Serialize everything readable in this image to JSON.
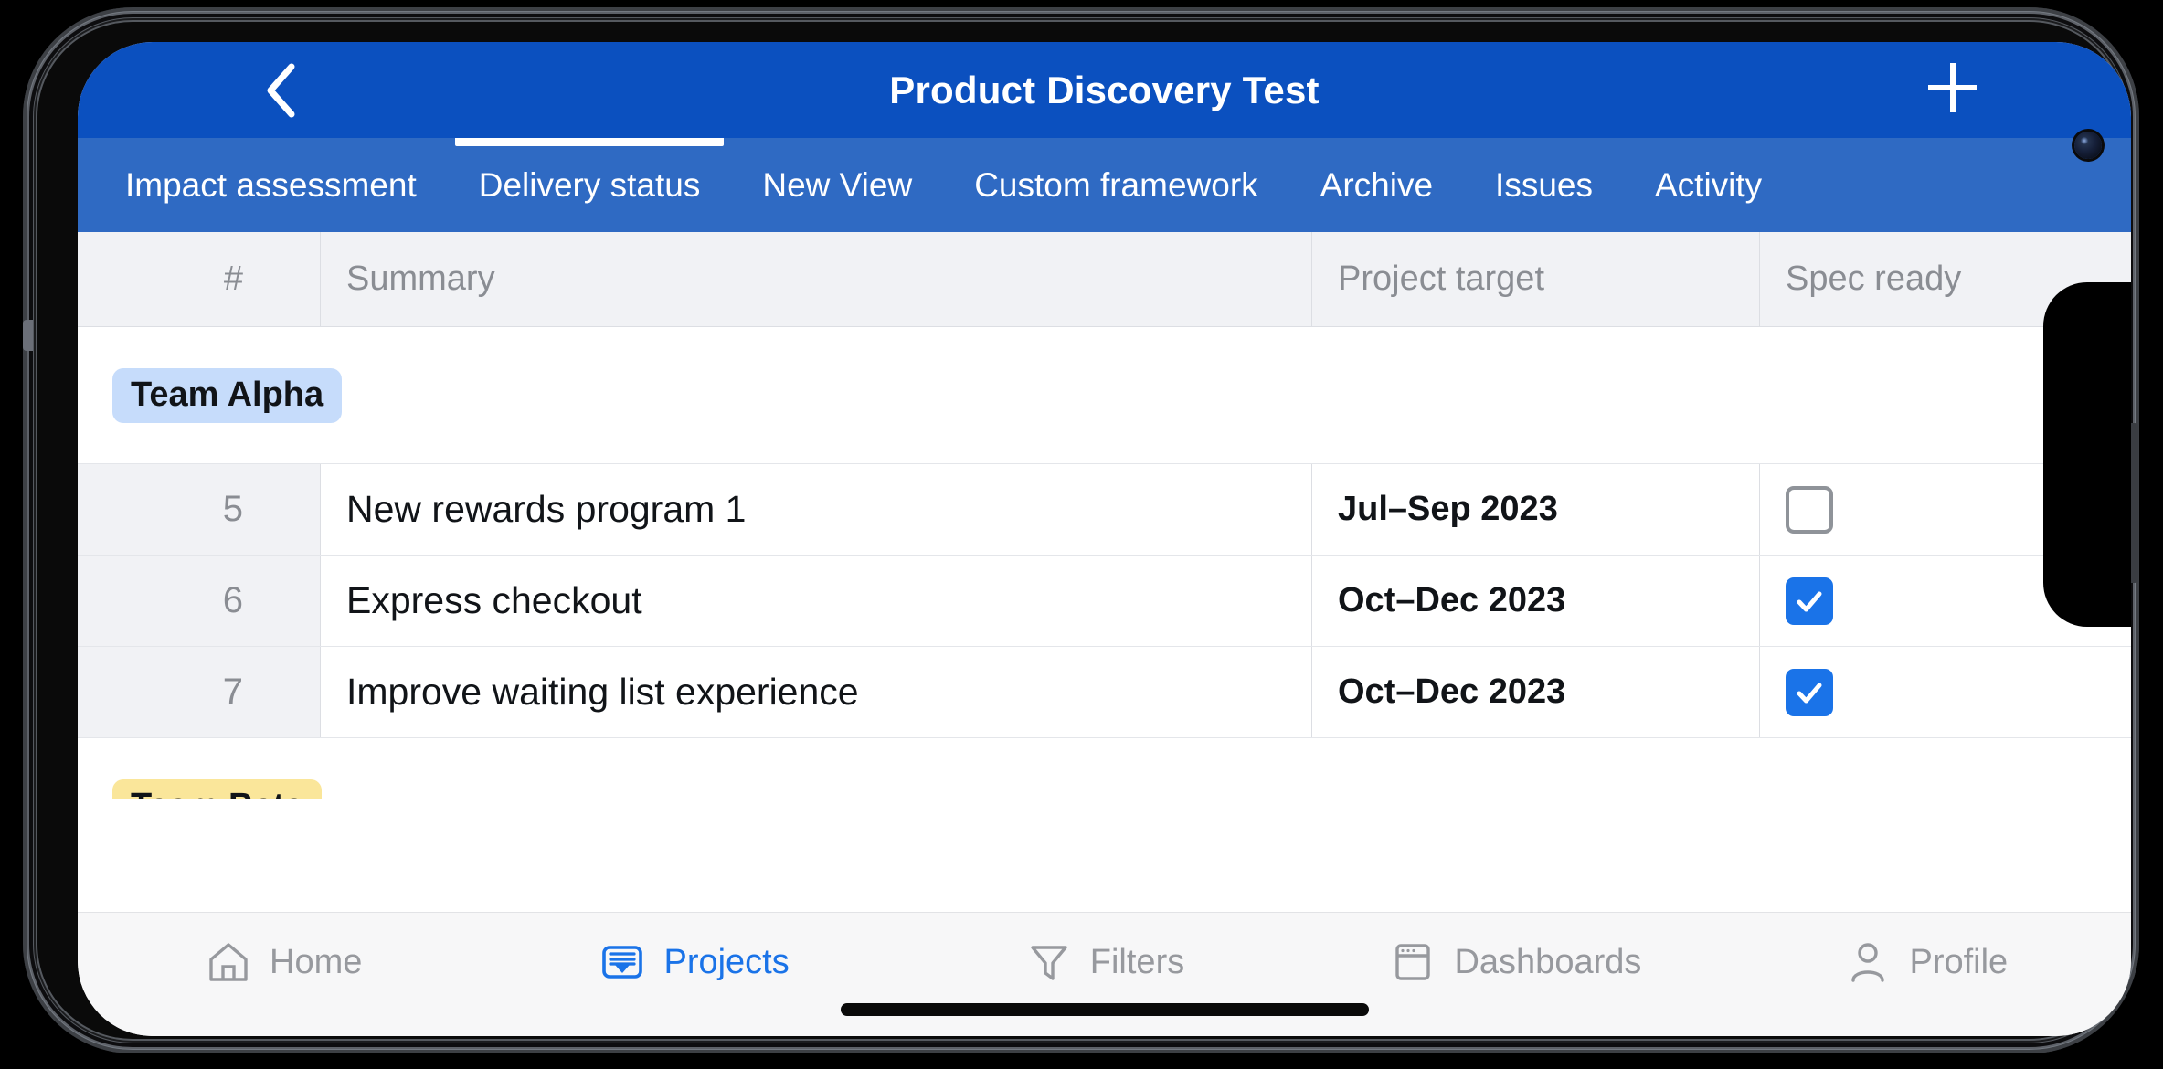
{
  "header": {
    "title": "Product Discovery Test",
    "back_icon": "chevron-left-icon",
    "add_icon": "plus-icon"
  },
  "tabs": [
    {
      "label": "Impact assessment",
      "active": false
    },
    {
      "label": "Delivery status",
      "active": true
    },
    {
      "label": "New View",
      "active": false
    },
    {
      "label": "Custom framework",
      "active": false
    },
    {
      "label": "Archive",
      "active": false
    },
    {
      "label": "Issues",
      "active": false
    },
    {
      "label": "Activity",
      "active": false
    }
  ],
  "table": {
    "columns": [
      "#",
      "Summary",
      "Project target",
      "Spec ready"
    ],
    "groups": [
      {
        "name": "Team Alpha",
        "badge_color": "#c6dcfb",
        "rows": [
          {
            "num": "5",
            "summary": "New rewards program 1",
            "target": "Jul–Sep 2023",
            "spec_ready": false
          },
          {
            "num": "6",
            "summary": "Express checkout",
            "target": "Oct–Dec 2023",
            "spec_ready": true
          },
          {
            "num": "7",
            "summary": "Improve waiting list experience",
            "target": "Oct–Dec 2023",
            "spec_ready": true
          }
        ]
      },
      {
        "name": "Team Beta",
        "badge_color": "#fae69a",
        "rows": []
      }
    ]
  },
  "bottom_nav": [
    {
      "label": "Home",
      "icon": "home-icon",
      "active": false
    },
    {
      "label": "Projects",
      "icon": "projects-icon",
      "active": true
    },
    {
      "label": "Filters",
      "icon": "filter-icon",
      "active": false
    },
    {
      "label": "Dashboards",
      "icon": "dashboard-icon",
      "active": false
    },
    {
      "label": "Profile",
      "icon": "person-icon",
      "active": false
    }
  ],
  "colors": {
    "header_blue": "#0b50bf",
    "tabbar_blue": "#2f6ac3",
    "accent_blue": "#1a73e8",
    "row_alt": "#f1f2f5"
  }
}
